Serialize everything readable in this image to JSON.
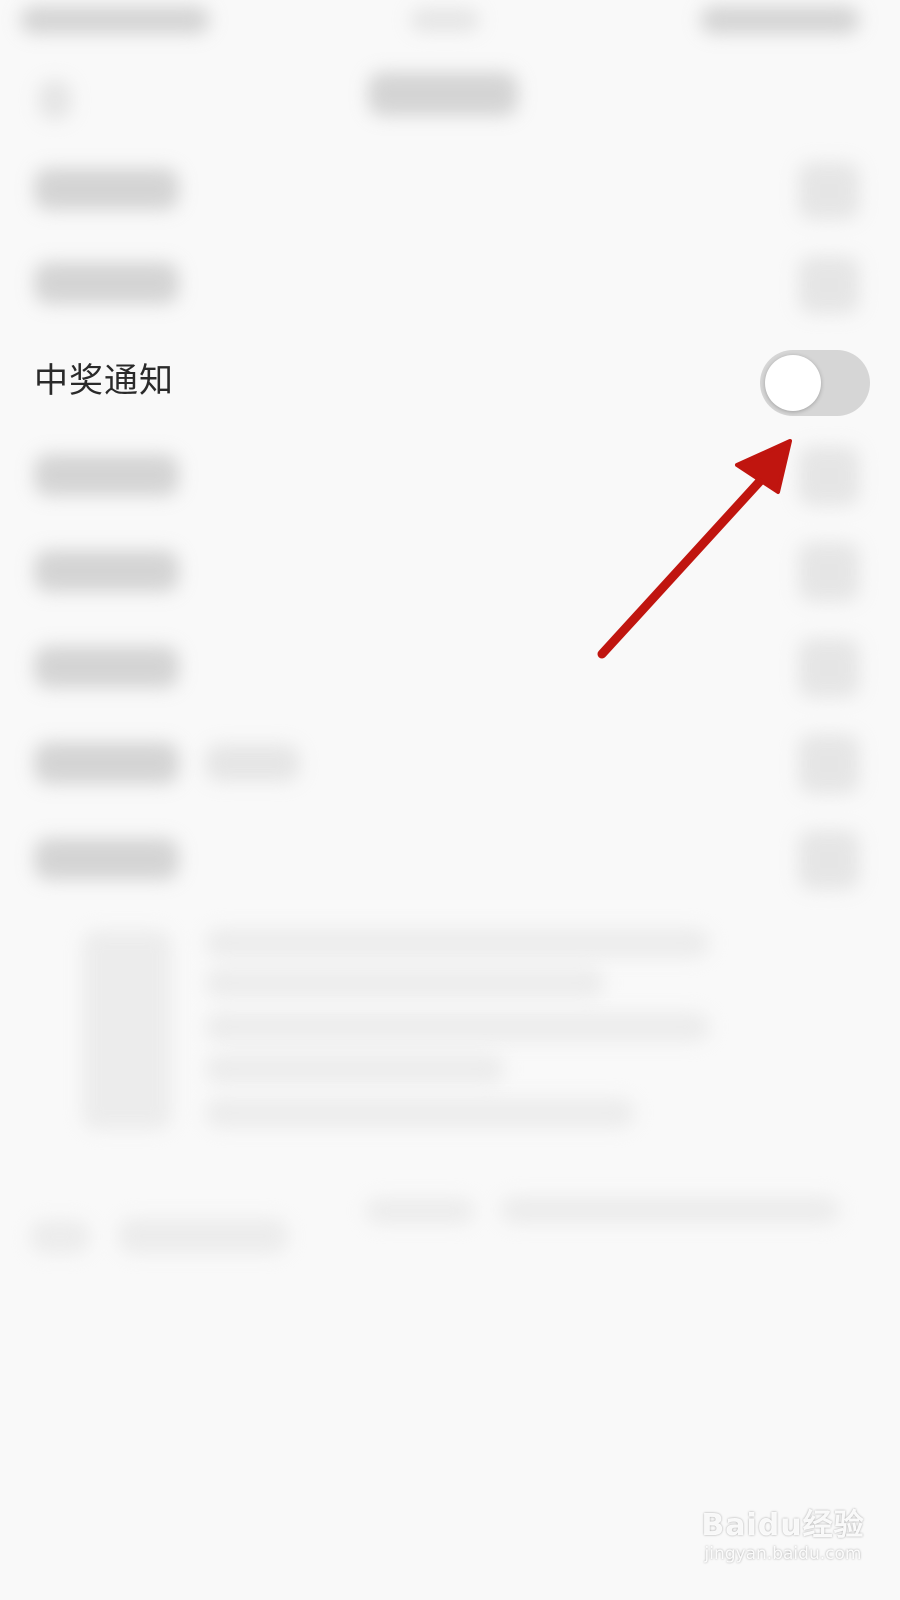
{
  "settings": {
    "visible_row": {
      "label": "中奖通知",
      "toggle_state": "off"
    }
  },
  "colors": {
    "toggle_off_track": "#d6d6d6",
    "toggle_knob": "#ffffff",
    "annotation_arrow": "#c0150f"
  },
  "watermark": {
    "brand": "Baidu经验",
    "url": "jingyan.baidu.com"
  }
}
